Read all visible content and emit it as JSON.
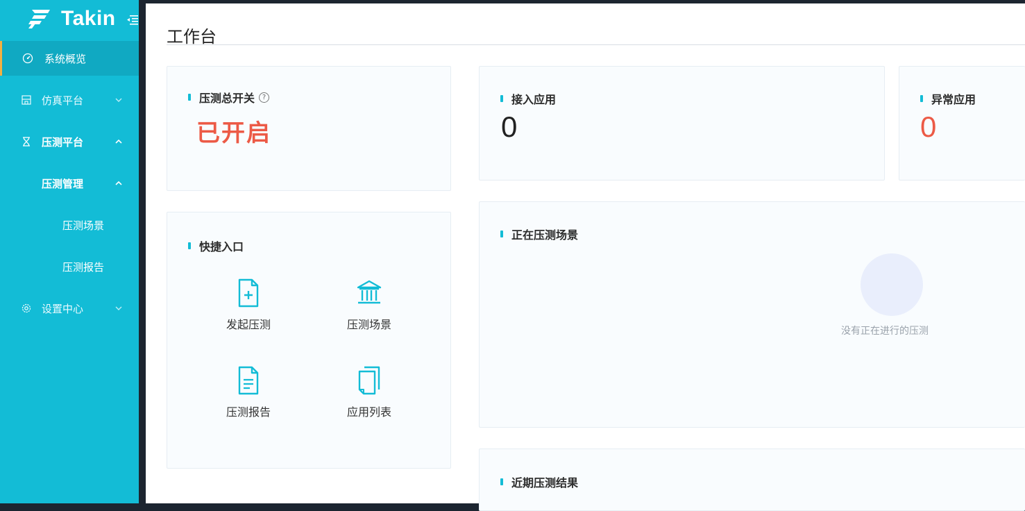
{
  "app": {
    "name": "Takin"
  },
  "sidebar": {
    "items": [
      {
        "label": "系统概览",
        "icon": "dashboard-icon"
      },
      {
        "label": "仿真平台",
        "icon": "building-icon"
      },
      {
        "label": "压测平台",
        "icon": "hourglass-icon"
      },
      {
        "label": "压测管理"
      },
      {
        "label": "压测场景"
      },
      {
        "label": "压测报告"
      },
      {
        "label": "设置中心",
        "icon": "gear-icon"
      }
    ]
  },
  "page": {
    "title": "工作台"
  },
  "switch_card": {
    "title": "压测总开关",
    "status": "已开启",
    "status_color": "#ec5a46"
  },
  "apps_card": {
    "title": "接入应用",
    "value": "0"
  },
  "abnormal_card": {
    "title": "异常应用",
    "value": "0",
    "value_color": "#ec5a46"
  },
  "shortcuts": {
    "title": "快捷入口",
    "items": [
      {
        "label": "发起压测",
        "icon": "add-file-icon"
      },
      {
        "label": "压测场景",
        "icon": "bank-icon"
      },
      {
        "label": "压测报告",
        "icon": "document-icon"
      },
      {
        "label": "应用列表",
        "icon": "copy-icon"
      }
    ]
  },
  "running_card": {
    "title": "正在压测场景",
    "empty_text": "没有正在进行的压测"
  },
  "recent_card": {
    "title": "近期压测结果"
  },
  "colors": {
    "sidebar": "#13bcd6",
    "accent": "#13bcd6",
    "alert": "#ec5a46"
  }
}
